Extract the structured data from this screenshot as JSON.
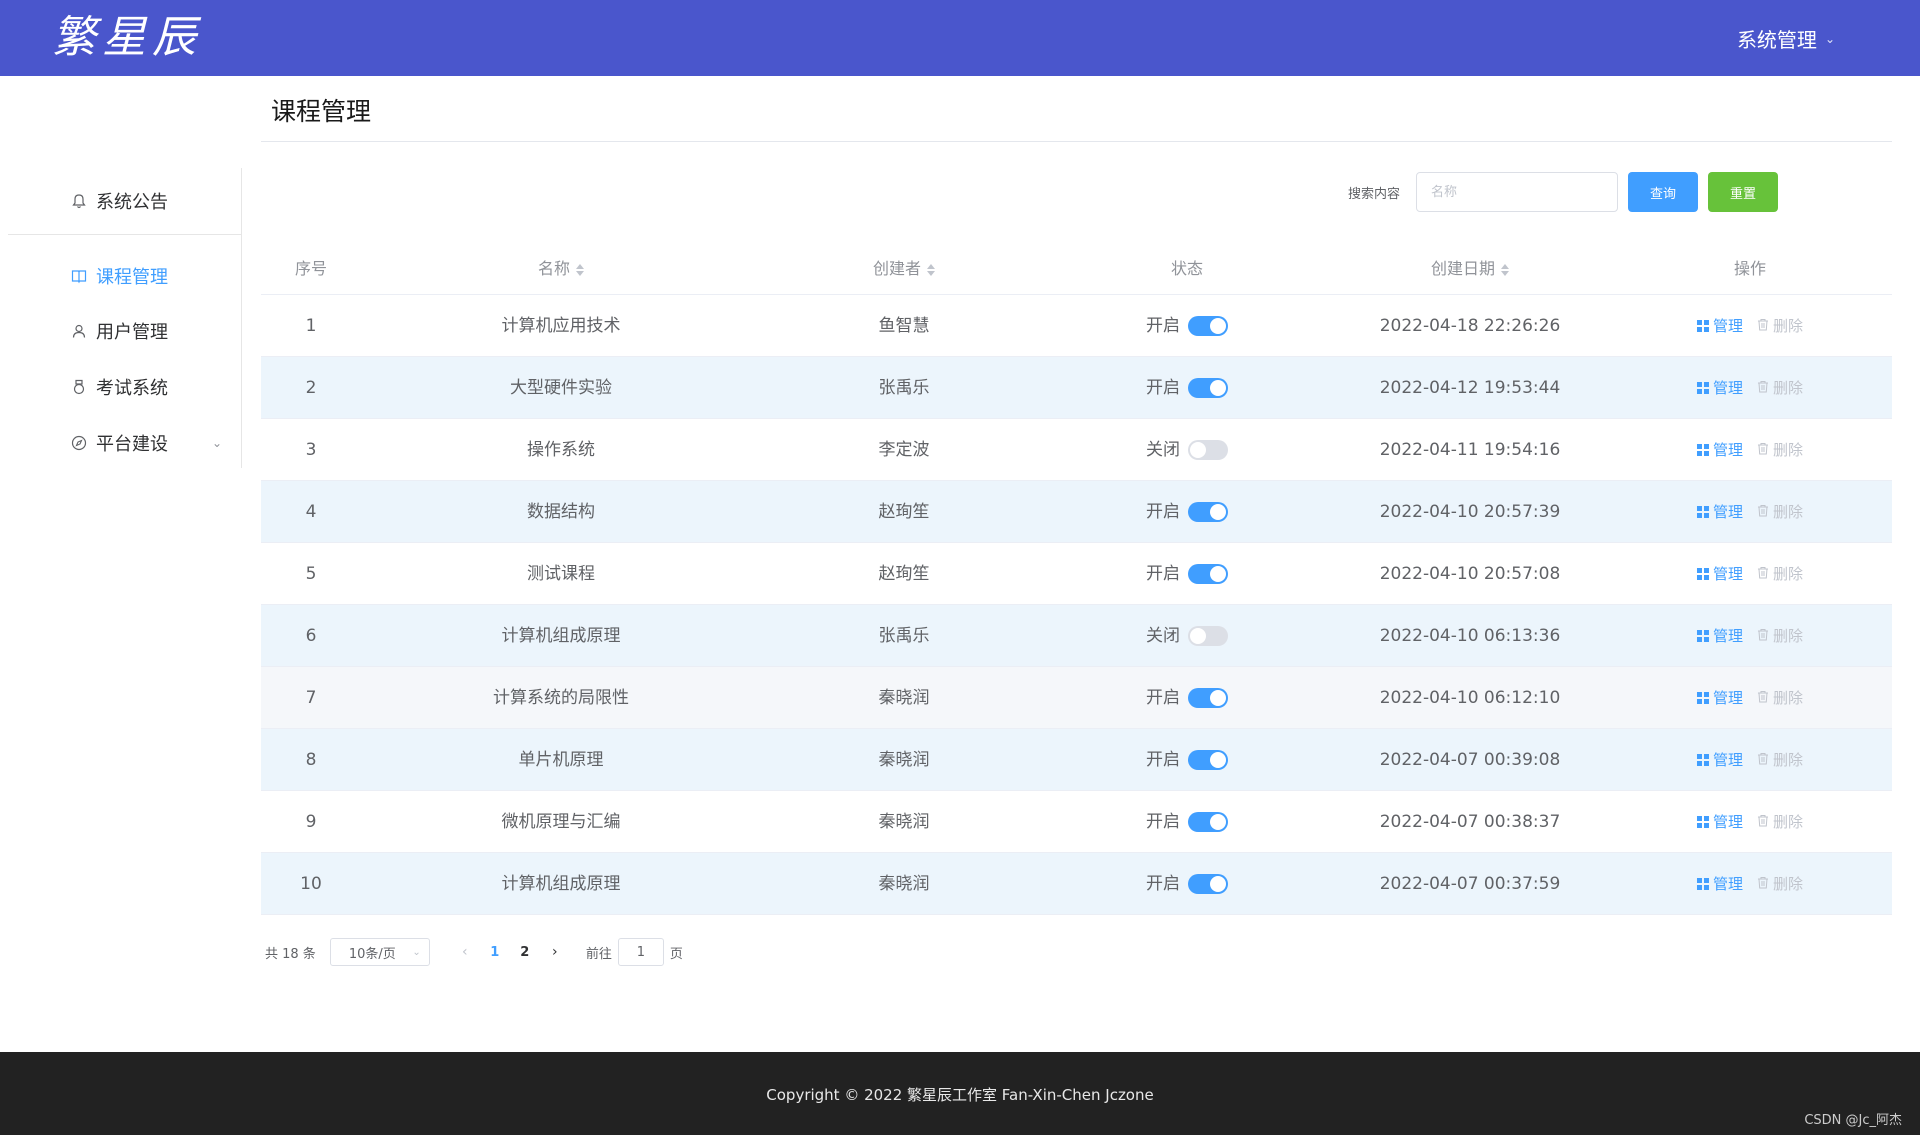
{
  "header": {
    "logo_text": "繁星辰",
    "system_menu": "系统管理"
  },
  "page": {
    "title": "课程管理"
  },
  "sidebar": {
    "items": [
      {
        "label": "系统公告",
        "icon": "bell-icon"
      },
      {
        "label": "课程管理",
        "icon": "book-icon",
        "active": true
      },
      {
        "label": "用户管理",
        "icon": "user-icon"
      },
      {
        "label": "考试系统",
        "icon": "medal-icon"
      },
      {
        "label": "平台建设",
        "icon": "compass-icon",
        "expandable": true
      }
    ]
  },
  "search": {
    "label": "搜索内容",
    "placeholder": "名称",
    "value": "",
    "query_label": "查询",
    "reset_label": "重置"
  },
  "table": {
    "columns": {
      "index": "序号",
      "name": "名称",
      "creator": "创建者",
      "status": "状态",
      "date": "创建日期",
      "ops": "操作"
    },
    "manage_label": "管理",
    "delete_label": "删除",
    "rows": [
      {
        "index": "1",
        "name": "计算机应用技术",
        "creator": "鱼智慧",
        "status": "开启",
        "on": true,
        "date": "2022-04-18 22:26:26"
      },
      {
        "index": "2",
        "name": "大型硬件实验",
        "creator": "张禹乐",
        "status": "开启",
        "on": true,
        "date": "2022-04-12 19:53:44"
      },
      {
        "index": "3",
        "name": "操作系统",
        "creator": "李定波",
        "status": "关闭",
        "on": false,
        "date": "2022-04-11 19:54:16"
      },
      {
        "index": "4",
        "name": "数据结构",
        "creator": "赵珣笙",
        "status": "开启",
        "on": true,
        "date": "2022-04-10 20:57:39"
      },
      {
        "index": "5",
        "name": "测试课程",
        "creator": "赵珣笙",
        "status": "开启",
        "on": true,
        "date": "2022-04-10 20:57:08"
      },
      {
        "index": "6",
        "name": "计算机组成原理",
        "creator": "张禹乐",
        "status": "关闭",
        "on": false,
        "date": "2022-04-10 06:13:36"
      },
      {
        "index": "7",
        "name": "计算系统的局限性",
        "creator": "秦晓润",
        "status": "开启",
        "on": true,
        "date": "2022-04-10 06:12:10"
      },
      {
        "index": "8",
        "name": "单片机原理",
        "creator": "秦晓润",
        "status": "开启",
        "on": true,
        "date": "2022-04-07 00:39:08"
      },
      {
        "index": "9",
        "name": "微机原理与汇编",
        "creator": "秦晓润",
        "status": "开启",
        "on": true,
        "date": "2022-04-07 00:38:37"
      },
      {
        "index": "10",
        "name": "计算机组成原理",
        "creator": "秦晓润",
        "status": "开启",
        "on": true,
        "date": "2022-04-07 00:37:59"
      }
    ]
  },
  "pagination": {
    "total": "共 18 条",
    "page_size": "10条/页",
    "pages": [
      "1",
      "2"
    ],
    "current": "1",
    "goto_prefix": "前往",
    "goto_value": "1",
    "goto_suffix": "页"
  },
  "footer": {
    "copyright": "Copyright © 2022 繁星辰工作室 Fan-Xin-Chen Jczone",
    "watermark": "CSDN @Jc_阿杰"
  },
  "colors": {
    "header": "#4a56cc",
    "primary": "#409eff",
    "success": "#67c23a",
    "footer": "#222222"
  }
}
